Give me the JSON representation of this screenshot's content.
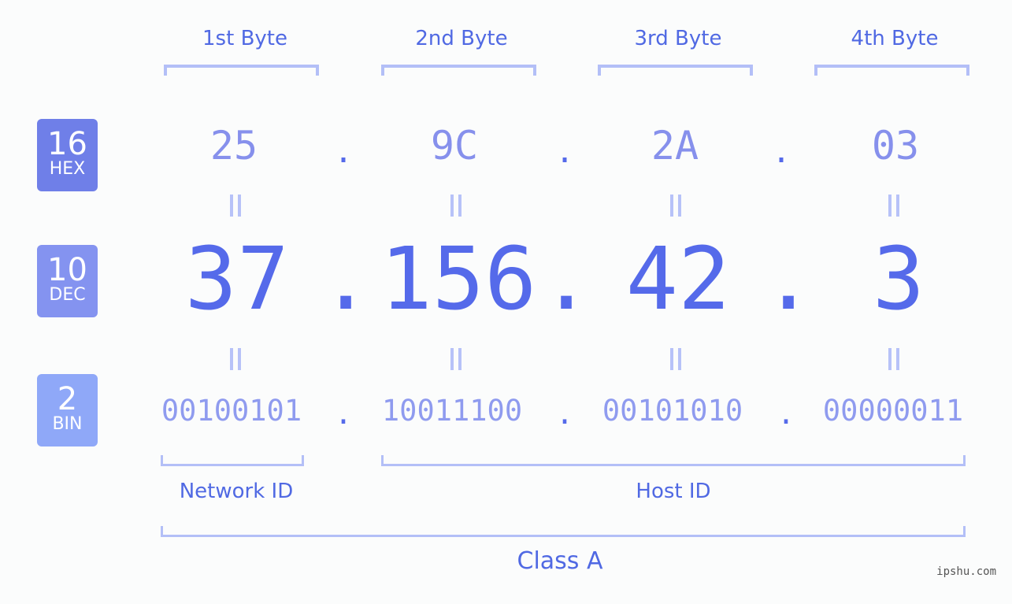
{
  "bytes": [
    {
      "label": "1st Byte",
      "hex": "25",
      "dec": "37",
      "bin": "00100101"
    },
    {
      "label": "2nd Byte",
      "hex": "9C",
      "dec": "156",
      "bin": "10011100"
    },
    {
      "label": "3rd Byte",
      "hex": "2A",
      "dec": "42",
      "bin": "00101010"
    },
    {
      "label": "4th Byte",
      "hex": "03",
      "dec": "3",
      "bin": "00000011"
    }
  ],
  "separator": ".",
  "badges": {
    "hex": {
      "base": "16",
      "name": "HEX",
      "color": "#6f7fe8"
    },
    "dec": {
      "base": "10",
      "name": "DEC",
      "color": "#8493f0"
    },
    "bin": {
      "base": "2",
      "name": "BIN",
      "color": "#8fa8f8"
    }
  },
  "network_id_label": "Network ID",
  "host_id_label": "Host ID",
  "class_label": "Class A",
  "watermark": "ipshu.com",
  "colors": {
    "accent": "#556aea",
    "bracket": "#b3bff7",
    "text": "#5069e3"
  }
}
